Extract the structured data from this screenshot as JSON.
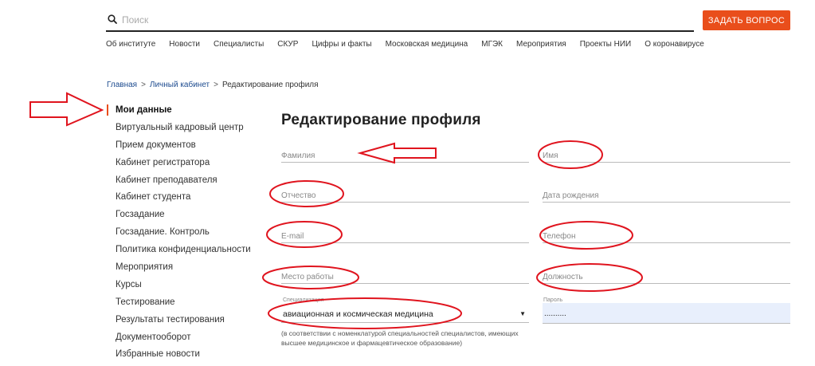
{
  "header": {
    "search_placeholder": "Поиск",
    "ask_button": "ЗАДАТЬ ВОПРОС"
  },
  "topnav": [
    "Об институте",
    "Новости",
    "Специалисты",
    "СКУР",
    "Цифры и факты",
    "Московская медицина",
    "МГЭК",
    "Мероприятия",
    "Проекты НИИ",
    "О коронавирусе"
  ],
  "breadcrumb": {
    "home": "Главная",
    "cabinet": "Личный кабинет",
    "current": "Редактирование профиля",
    "separator": ">"
  },
  "sidebar": {
    "items": [
      "Мои данные",
      "Виртуальный кадровый центр",
      "Прием документов",
      "Кабинет регистратора",
      "Кабинет преподавателя",
      "Кабинет студента",
      "Госзадание",
      "Госзадание. Контроль",
      "Политика конфиденциальности",
      "Мероприятия",
      "Курсы",
      "Тестирование",
      "Результаты тестирования",
      "Документооборот",
      "Избранные новости"
    ]
  },
  "form": {
    "title": "Редактирование профиля",
    "last_name_placeholder": "Фамилия",
    "first_name_placeholder": "Имя",
    "middle_name_placeholder": "Отчество",
    "birth_date_placeholder": "Дата рождения",
    "email_placeholder": "E-mail",
    "phone_placeholder": "Телефон",
    "workplace_placeholder": "Место работы",
    "position_placeholder": "Должность",
    "specialization_label": "Специализация",
    "specialization_value": "авиационная и космическая медицина",
    "password_label": "Пароль",
    "password_value": "..........",
    "note": "(в соответствии с номенклатурой специальностей специалистов, имеющих высшее медицинское и фармацевтическое образование)"
  },
  "colors": {
    "accent": "#e94e1b",
    "annotation": "#e0141e",
    "link": "#1d4b8f"
  }
}
